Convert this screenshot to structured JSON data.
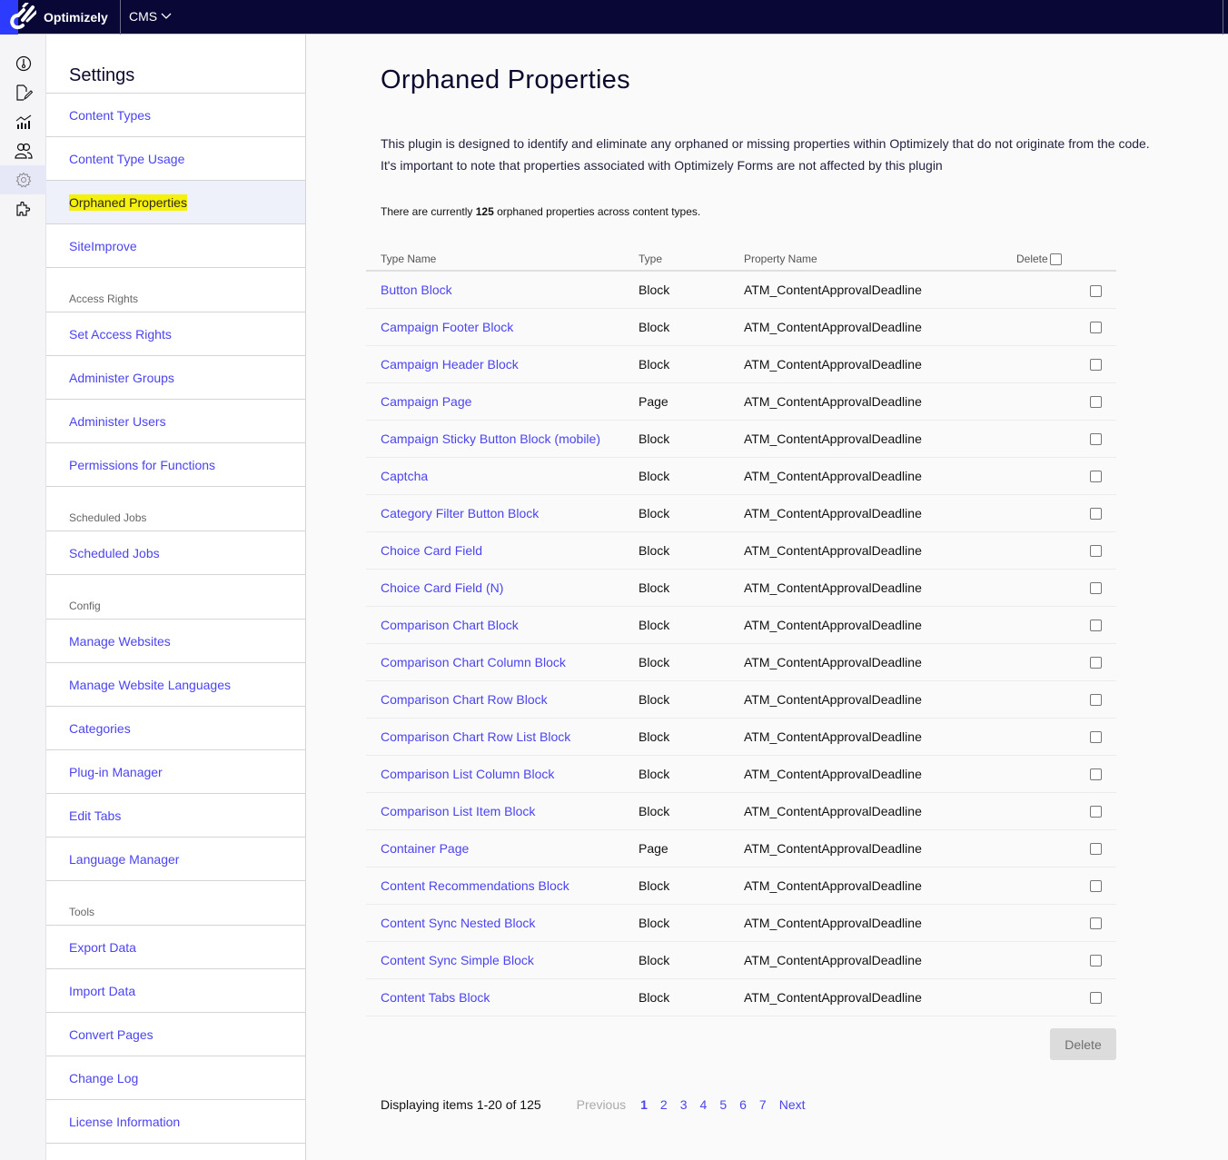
{
  "topbar": {
    "brand": "Optimizely",
    "product": "CMS",
    "product_chevron": "chevron-down-icon",
    "colors": {
      "bar": "#080736",
      "logo_bg": "#2d3bff"
    }
  },
  "rail": {
    "icons": [
      {
        "name": "dashboard-icon"
      },
      {
        "name": "edit-page-icon"
      },
      {
        "name": "analytics-icon"
      },
      {
        "name": "users-icon"
      },
      {
        "name": "settings-icon",
        "active": true
      },
      {
        "name": "addons-icon"
      }
    ]
  },
  "sidebar": {
    "title": "Settings",
    "items": [
      {
        "type": "link",
        "label": "Content Types"
      },
      {
        "type": "link",
        "label": "Content Type Usage"
      },
      {
        "type": "link",
        "label": "Orphaned Properties",
        "active": true
      },
      {
        "type": "link",
        "label": "SiteImprove"
      },
      {
        "type": "section",
        "label": "Access Rights"
      },
      {
        "type": "link",
        "label": "Set Access Rights"
      },
      {
        "type": "link",
        "label": "Administer Groups"
      },
      {
        "type": "link",
        "label": "Administer Users"
      },
      {
        "type": "link",
        "label": "Permissions for Functions"
      },
      {
        "type": "section",
        "label": "Scheduled Jobs"
      },
      {
        "type": "link",
        "label": "Scheduled Jobs"
      },
      {
        "type": "section",
        "label": "Config"
      },
      {
        "type": "link",
        "label": "Manage Websites"
      },
      {
        "type": "link",
        "label": "Manage Website Languages"
      },
      {
        "type": "link",
        "label": "Categories"
      },
      {
        "type": "link",
        "label": "Plug-in Manager"
      },
      {
        "type": "link",
        "label": "Edit Tabs"
      },
      {
        "type": "link",
        "label": "Language Manager"
      },
      {
        "type": "section",
        "label": "Tools"
      },
      {
        "type": "link",
        "label": "Export Data"
      },
      {
        "type": "link",
        "label": "Import Data"
      },
      {
        "type": "link",
        "label": "Convert Pages"
      },
      {
        "type": "link",
        "label": "Change Log"
      },
      {
        "type": "link",
        "label": "License Information"
      }
    ]
  },
  "main": {
    "title": "Orphaned Properties",
    "description_line1": "This plugin is designed to identify and eliminate any orphaned or missing properties within Optimizely that do not originate from the code.",
    "description_line2": "It's important to note that properties associated with Optimizely Forms are not affected by this plugin",
    "count_prefix": "There are currently ",
    "count_value": "125",
    "count_suffix": " orphaned properties across content types.",
    "table": {
      "headers": [
        "Type Name",
        "Type",
        "Property Name",
        "Delete"
      ],
      "rows": [
        {
          "type_name": "Button Block",
          "type": "Block",
          "property": "ATM_ContentApprovalDeadline",
          "checked": false
        },
        {
          "type_name": "Campaign Footer Block",
          "type": "Block",
          "property": "ATM_ContentApprovalDeadline",
          "checked": false
        },
        {
          "type_name": "Campaign Header Block",
          "type": "Block",
          "property": "ATM_ContentApprovalDeadline",
          "checked": false
        },
        {
          "type_name": "Campaign Page",
          "type": "Page",
          "property": "ATM_ContentApprovalDeadline",
          "checked": false
        },
        {
          "type_name": "Campaign Sticky Button Block (mobile)",
          "type": "Block",
          "property": "ATM_ContentApprovalDeadline",
          "checked": false
        },
        {
          "type_name": "Captcha",
          "type": "Block",
          "property": "ATM_ContentApprovalDeadline",
          "checked": false
        },
        {
          "type_name": "Category Filter Button Block",
          "type": "Block",
          "property": "ATM_ContentApprovalDeadline",
          "checked": false
        },
        {
          "type_name": "Choice Card Field",
          "type": "Block",
          "property": "ATM_ContentApprovalDeadline",
          "checked": false
        },
        {
          "type_name": "Choice Card Field (N)",
          "type": "Block",
          "property": "ATM_ContentApprovalDeadline",
          "checked": false
        },
        {
          "type_name": "Comparison Chart Block",
          "type": "Block",
          "property": "ATM_ContentApprovalDeadline",
          "checked": false
        },
        {
          "type_name": "Comparison Chart Column Block",
          "type": "Block",
          "property": "ATM_ContentApprovalDeadline",
          "checked": false
        },
        {
          "type_name": "Comparison Chart Row Block",
          "type": "Block",
          "property": "ATM_ContentApprovalDeadline",
          "checked": false
        },
        {
          "type_name": "Comparison Chart Row List Block",
          "type": "Block",
          "property": "ATM_ContentApprovalDeadline",
          "checked": false
        },
        {
          "type_name": "Comparison List Column Block",
          "type": "Block",
          "property": "ATM_ContentApprovalDeadline",
          "checked": false
        },
        {
          "type_name": "Comparison List Item Block",
          "type": "Block",
          "property": "ATM_ContentApprovalDeadline",
          "checked": false
        },
        {
          "type_name": "Container Page",
          "type": "Page",
          "property": "ATM_ContentApprovalDeadline",
          "checked": false
        },
        {
          "type_name": "Content Recommendations Block",
          "type": "Block",
          "property": "ATM_ContentApprovalDeadline",
          "checked": false
        },
        {
          "type_name": "Content Sync Nested Block",
          "type": "Block",
          "property": "ATM_ContentApprovalDeadline",
          "checked": false
        },
        {
          "type_name": "Content Sync Simple Block",
          "type": "Block",
          "property": "ATM_ContentApprovalDeadline",
          "checked": false
        },
        {
          "type_name": "Content Tabs Block",
          "type": "Block",
          "property": "ATM_ContentApprovalDeadline",
          "checked": false
        }
      ]
    },
    "delete_button": "Delete",
    "pagination": {
      "info": "Displaying items 1-20 of 125",
      "previous": "Previous",
      "pages": [
        "1",
        "2",
        "3",
        "4",
        "5",
        "6",
        "7"
      ],
      "current_page": "1",
      "next": "Next"
    }
  }
}
